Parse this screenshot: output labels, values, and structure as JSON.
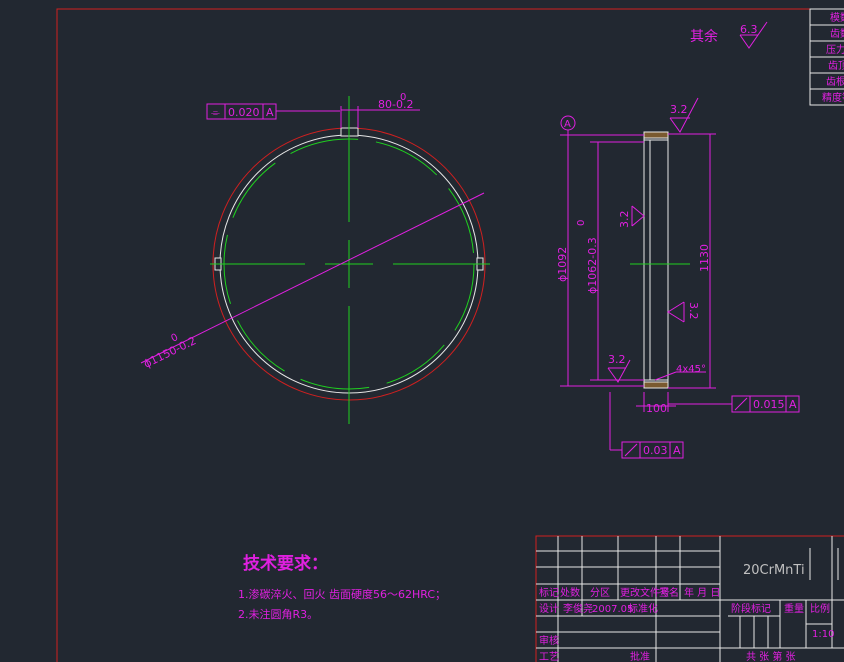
{
  "roughness": {
    "rest_label": "其余",
    "rest_value": "6.3",
    "face_top": "3.2",
    "face_bottom": "3.2",
    "bore": "3.2",
    "outer": "3.2"
  },
  "left_view": {
    "tolerance_symbol": "⌯",
    "tolerance_value": "0.020",
    "tolerance_datum": "A",
    "slot_width": "80-0.2",
    "slot_upper": "0",
    "diameter_label": "ϕ1150-0.2",
    "diameter_upper": "0"
  },
  "right_view": {
    "datum": "A",
    "outer_dia": "ϕ1092",
    "inner_dia": "ϕ1062-0.3",
    "inner_upper": "0",
    "height": "1130",
    "width": "100",
    "chamfer": "4x45°",
    "runout1": "0.015",
    "runout1_datum": "A",
    "runout2": "0.03",
    "runout2_datum": "A"
  },
  "notes": {
    "title": "技术要求：",
    "line1": "1.渗碳淬火、回火 齿面硬度56～62HRC；",
    "line2": "2.未注圆角R3。"
  },
  "param_table": [
    "模数",
    "齿数",
    "压力角",
    "齿顶高",
    "齿根高",
    "精度等级"
  ],
  "title_block": {
    "material": "20CrMnTi",
    "hdr1": "标记",
    "hdr2": "处数",
    "hdr3": "分区",
    "hdr4": "更改文件号",
    "hdr5": "签名",
    "hdr6": "年 月 日",
    "design": "设计",
    "designer": "李俊尧",
    "date": "2007.05",
    "std": "标准化",
    "stage": "阶段标记",
    "weight": "重量",
    "scale_label": "比例",
    "scale": "1:10",
    "review": "审核",
    "process": "工艺",
    "approve": "批准",
    "sheets": "共 张 第 张"
  },
  "colors": {
    "background": "#222831",
    "frame": "#d02020",
    "dimension": "#e020e0",
    "centerline": "#20d020",
    "object": "#e8e8e8"
  }
}
